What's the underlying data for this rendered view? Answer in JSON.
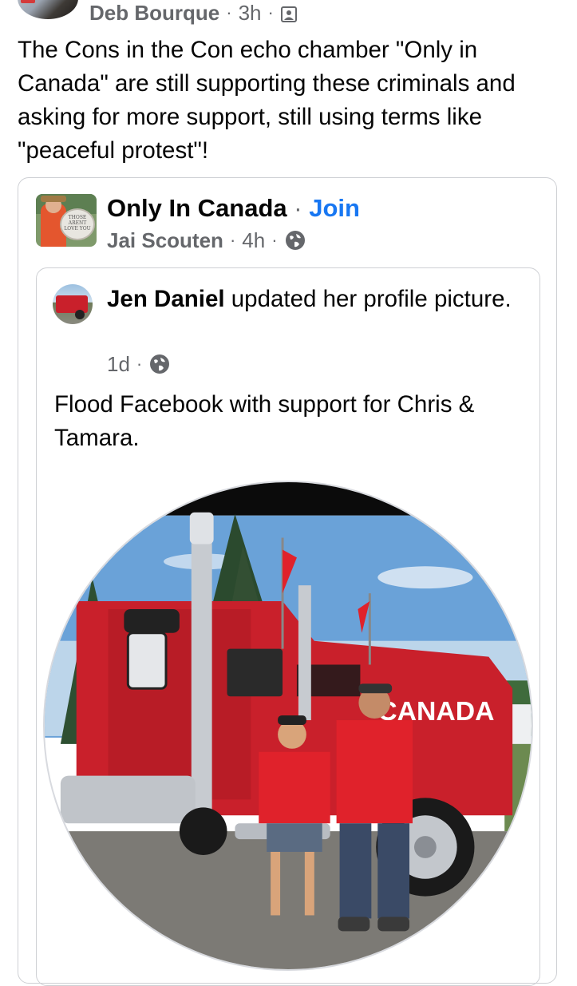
{
  "post": {
    "author": "Deb Bourque",
    "time": "3h",
    "separator": "·",
    "audience_icon": "album-icon",
    "text": "The Cons in the Con echo chamber \"Only in Canada\" are still supporting these criminals and asking for more support, still using terms like \"peaceful protest\"!"
  },
  "shared": {
    "group_name": "Only In Canada",
    "separator": "·",
    "join_label": "Join",
    "poster": "Jai Scouten",
    "time": "4h",
    "audience_icon": "globe-icon",
    "avatar_sign": "THOSE ARENT LOVE YOU"
  },
  "inner": {
    "author": "Jen Daniel",
    "action": " updated her profile picture.",
    "time": "1d",
    "separator": "·",
    "audience_icon": "globe-icon",
    "body": "Flood Facebook with support for Chris & Tamara.",
    "truck_text": "CANADA"
  },
  "colors": {
    "link_blue": "#1877f2",
    "meta_gray": "#65676b",
    "truck_red": "#c9202b",
    "shirt_red": "#e0222b"
  }
}
